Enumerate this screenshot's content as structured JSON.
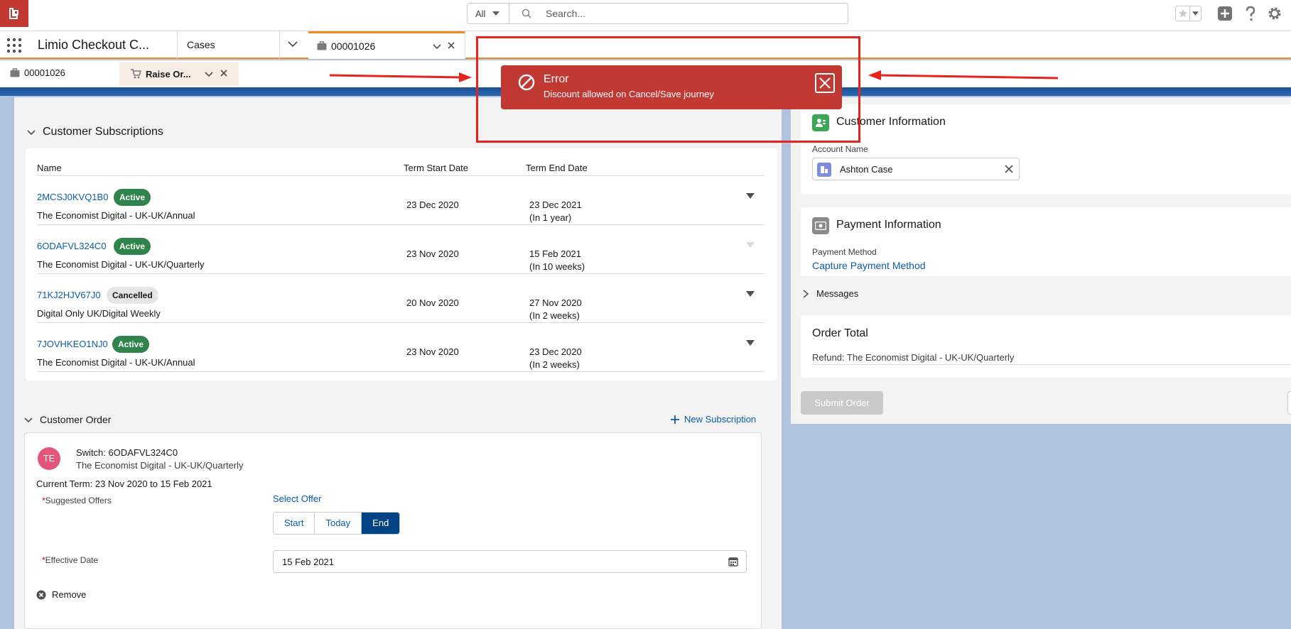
{
  "colors": {
    "brand_red": "#c23934",
    "nav_accent": "#f38a1f",
    "link": "#0b5cab",
    "active_badge": "#2e844a",
    "brand_button": "#014486",
    "annotation": "#e8231f"
  },
  "header": {
    "search_scope": "All",
    "search_placeholder": "Search..."
  },
  "nav": {
    "app_name": "Limio Checkout C...",
    "cases_label": "Cases",
    "case_tab_label": "00001026"
  },
  "subtabs": {
    "case_label": "00001026",
    "raise_label": "Raise Or..."
  },
  "subscriptions": {
    "title": "Customer Subscriptions",
    "columns": [
      "Name",
      "Term Start Date",
      "Term End Date"
    ],
    "rows": [
      {
        "id": "2MCSJ0KVQ1B0",
        "status": "Active",
        "product": "The Economist Digital - UK-UK/Annual",
        "start": "23 Dec 2020",
        "end": "23 Dec 2021",
        "relative": "(In 1 year)"
      },
      {
        "id": "6ODAFVL324C0",
        "status": "Active",
        "product": "The Economist Digital - UK-UK/Quarterly",
        "start": "23 Nov 2020",
        "end": "15 Feb 2021",
        "relative": "(In 10 weeks)"
      },
      {
        "id": "71KJ2HJV67J0",
        "status": "Cancelled",
        "product": "Digital Only UK/Digital Weekly",
        "start": "20 Nov 2020",
        "end": "27 Nov 2020",
        "relative": "(In 2 weeks)"
      },
      {
        "id": "7JOVHKEO1NJ0",
        "status": "Active",
        "product": "The Economist Digital - UK-UK/Annual",
        "start": "23 Nov 2020",
        "end": "23 Dec 2020",
        "relative": "(In 2 weeks)"
      }
    ]
  },
  "order": {
    "title": "Customer Order",
    "new_subscription": "New Subscription",
    "avatar": "TE",
    "switch_title": "Switch: 6ODAFVL324C0",
    "product": "The Economist Digital - UK-UK/Quarterly",
    "current_term": "Current Term: 23 Nov 2020 to 15 Feb 2021",
    "offers_label": "Suggested Offers",
    "select_offer": "Select Offer",
    "segments": [
      "Start",
      "Today",
      "End"
    ],
    "selected_segment": "End",
    "effective_label": "Effective Date",
    "effective_value": "15 Feb 2021",
    "remove": "Remove"
  },
  "customer_info": {
    "title": "Customer Information",
    "account_label": "Account Name",
    "account_value": "Ashton Case"
  },
  "payment_info": {
    "title": "Payment Information",
    "method_label": "Payment Method",
    "method_link": "Capture Payment Method"
  },
  "messages": {
    "label": "Messages"
  },
  "order_total": {
    "title": "Order Total",
    "line": "Refund: The Economist Digital - UK-UK/Quarterly"
  },
  "submit": {
    "label": "Submit Order"
  },
  "error": {
    "title": "Error",
    "message": "Discount allowed on Cancel/Save journey"
  }
}
